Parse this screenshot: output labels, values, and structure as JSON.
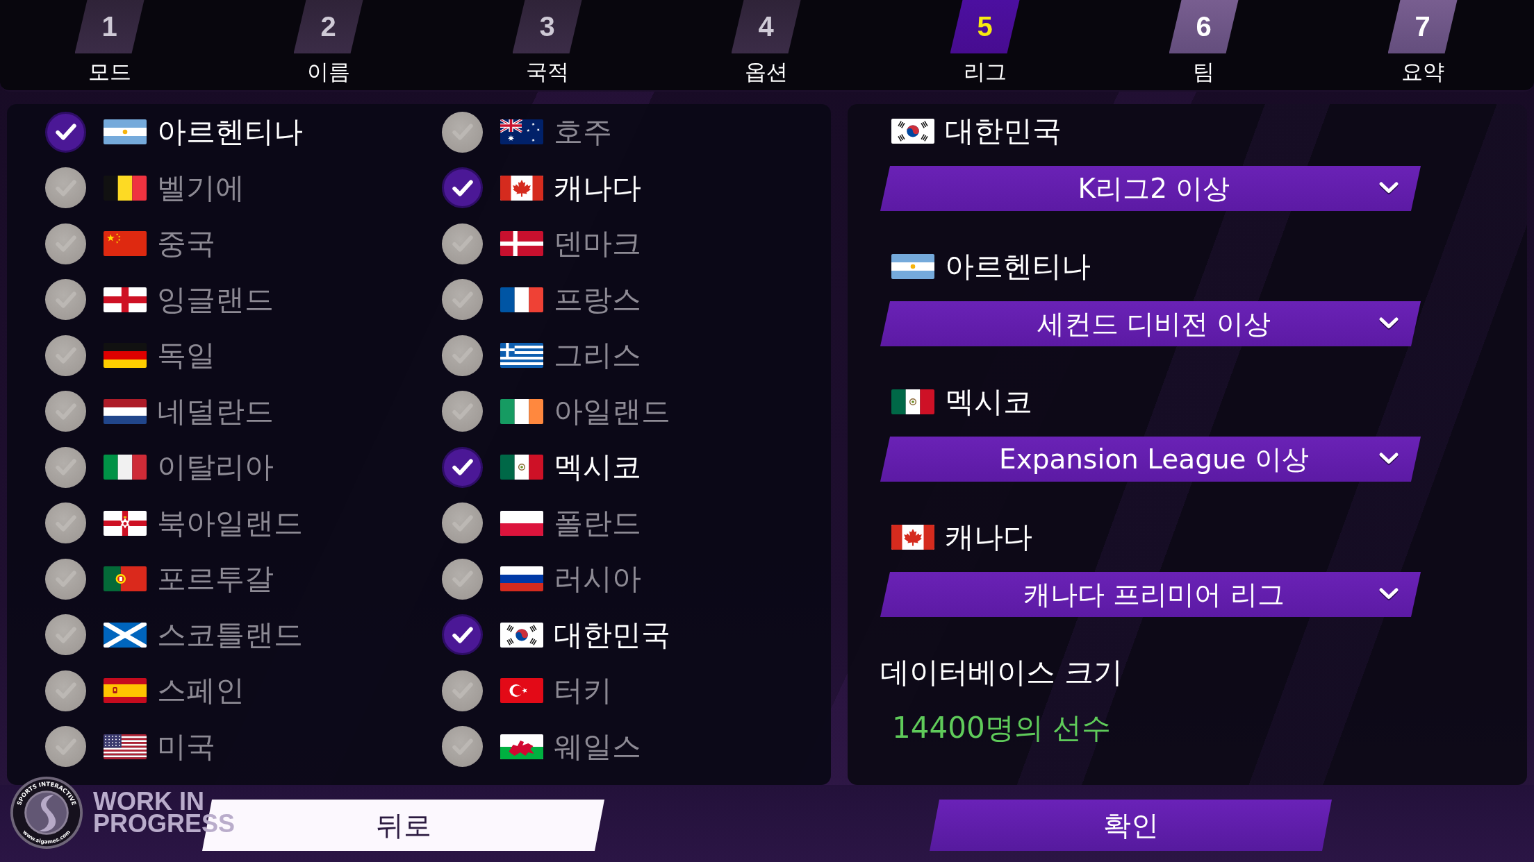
{
  "steps": [
    {
      "number": "1",
      "label": "모드",
      "selected": false,
      "completed": true
    },
    {
      "number": "2",
      "label": "이름",
      "selected": false,
      "completed": true
    },
    {
      "number": "3",
      "label": "국적",
      "selected": false,
      "completed": true
    },
    {
      "number": "4",
      "label": "옵션",
      "selected": false,
      "completed": true
    },
    {
      "number": "5",
      "label": "리그",
      "selected": true,
      "completed": false
    },
    {
      "number": "6",
      "label": "팀",
      "selected": false,
      "completed": false
    },
    {
      "number": "7",
      "label": "요약",
      "selected": false,
      "completed": false
    }
  ],
  "nations": [
    {
      "name": "아르헨티나",
      "checked": true
    },
    {
      "name": "벨기에",
      "checked": false
    },
    {
      "name": "중국",
      "checked": false
    },
    {
      "name": "잉글랜드",
      "checked": false
    },
    {
      "name": "독일",
      "checked": false
    },
    {
      "name": "네덜란드",
      "checked": false
    },
    {
      "name": "이탈리아",
      "checked": false
    },
    {
      "name": "북아일랜드",
      "checked": false
    },
    {
      "name": "포르투갈",
      "checked": false
    },
    {
      "name": "스코틀랜드",
      "checked": false
    },
    {
      "name": "스페인",
      "checked": false
    },
    {
      "name": "미국",
      "checked": false
    },
    {
      "name": "호주",
      "checked": false
    },
    {
      "name": "캐나다",
      "checked": true
    },
    {
      "name": "덴마크",
      "checked": false
    },
    {
      "name": "프랑스",
      "checked": false
    },
    {
      "name": "그리스",
      "checked": false
    },
    {
      "name": "아일랜드",
      "checked": false
    },
    {
      "name": "멕시코",
      "checked": true
    },
    {
      "name": "폴란드",
      "checked": false
    },
    {
      "name": "러시아",
      "checked": false
    },
    {
      "name": "대한민국",
      "checked": true
    },
    {
      "name": "터키",
      "checked": false
    },
    {
      "name": "웨일스",
      "checked": false
    }
  ],
  "leagues": [
    {
      "nation": "대한민국",
      "league": "K리그2 이상"
    },
    {
      "nation": "아르헨티나",
      "league": "세컨드 디비전 이상"
    },
    {
      "nation": "멕시코",
      "league": "Expansion League 이상"
    },
    {
      "nation": "캐나다",
      "league": "캐나다 프리미어 리그"
    }
  ],
  "database_size": {
    "label": "데이터베이스 크기",
    "value": "14400명의 선수"
  },
  "buttons": [
    {
      "label": "뒤로",
      "kind": "back"
    },
    {
      "label": "확인",
      "kind": "confirm"
    }
  ],
  "build_badge": {
    "badge_top": "SPORTS INTERACTIVE",
    "badge_bottom": "www.sigames.com",
    "line_1": "WORK IN",
    "line_2": "PROGRESS"
  }
}
